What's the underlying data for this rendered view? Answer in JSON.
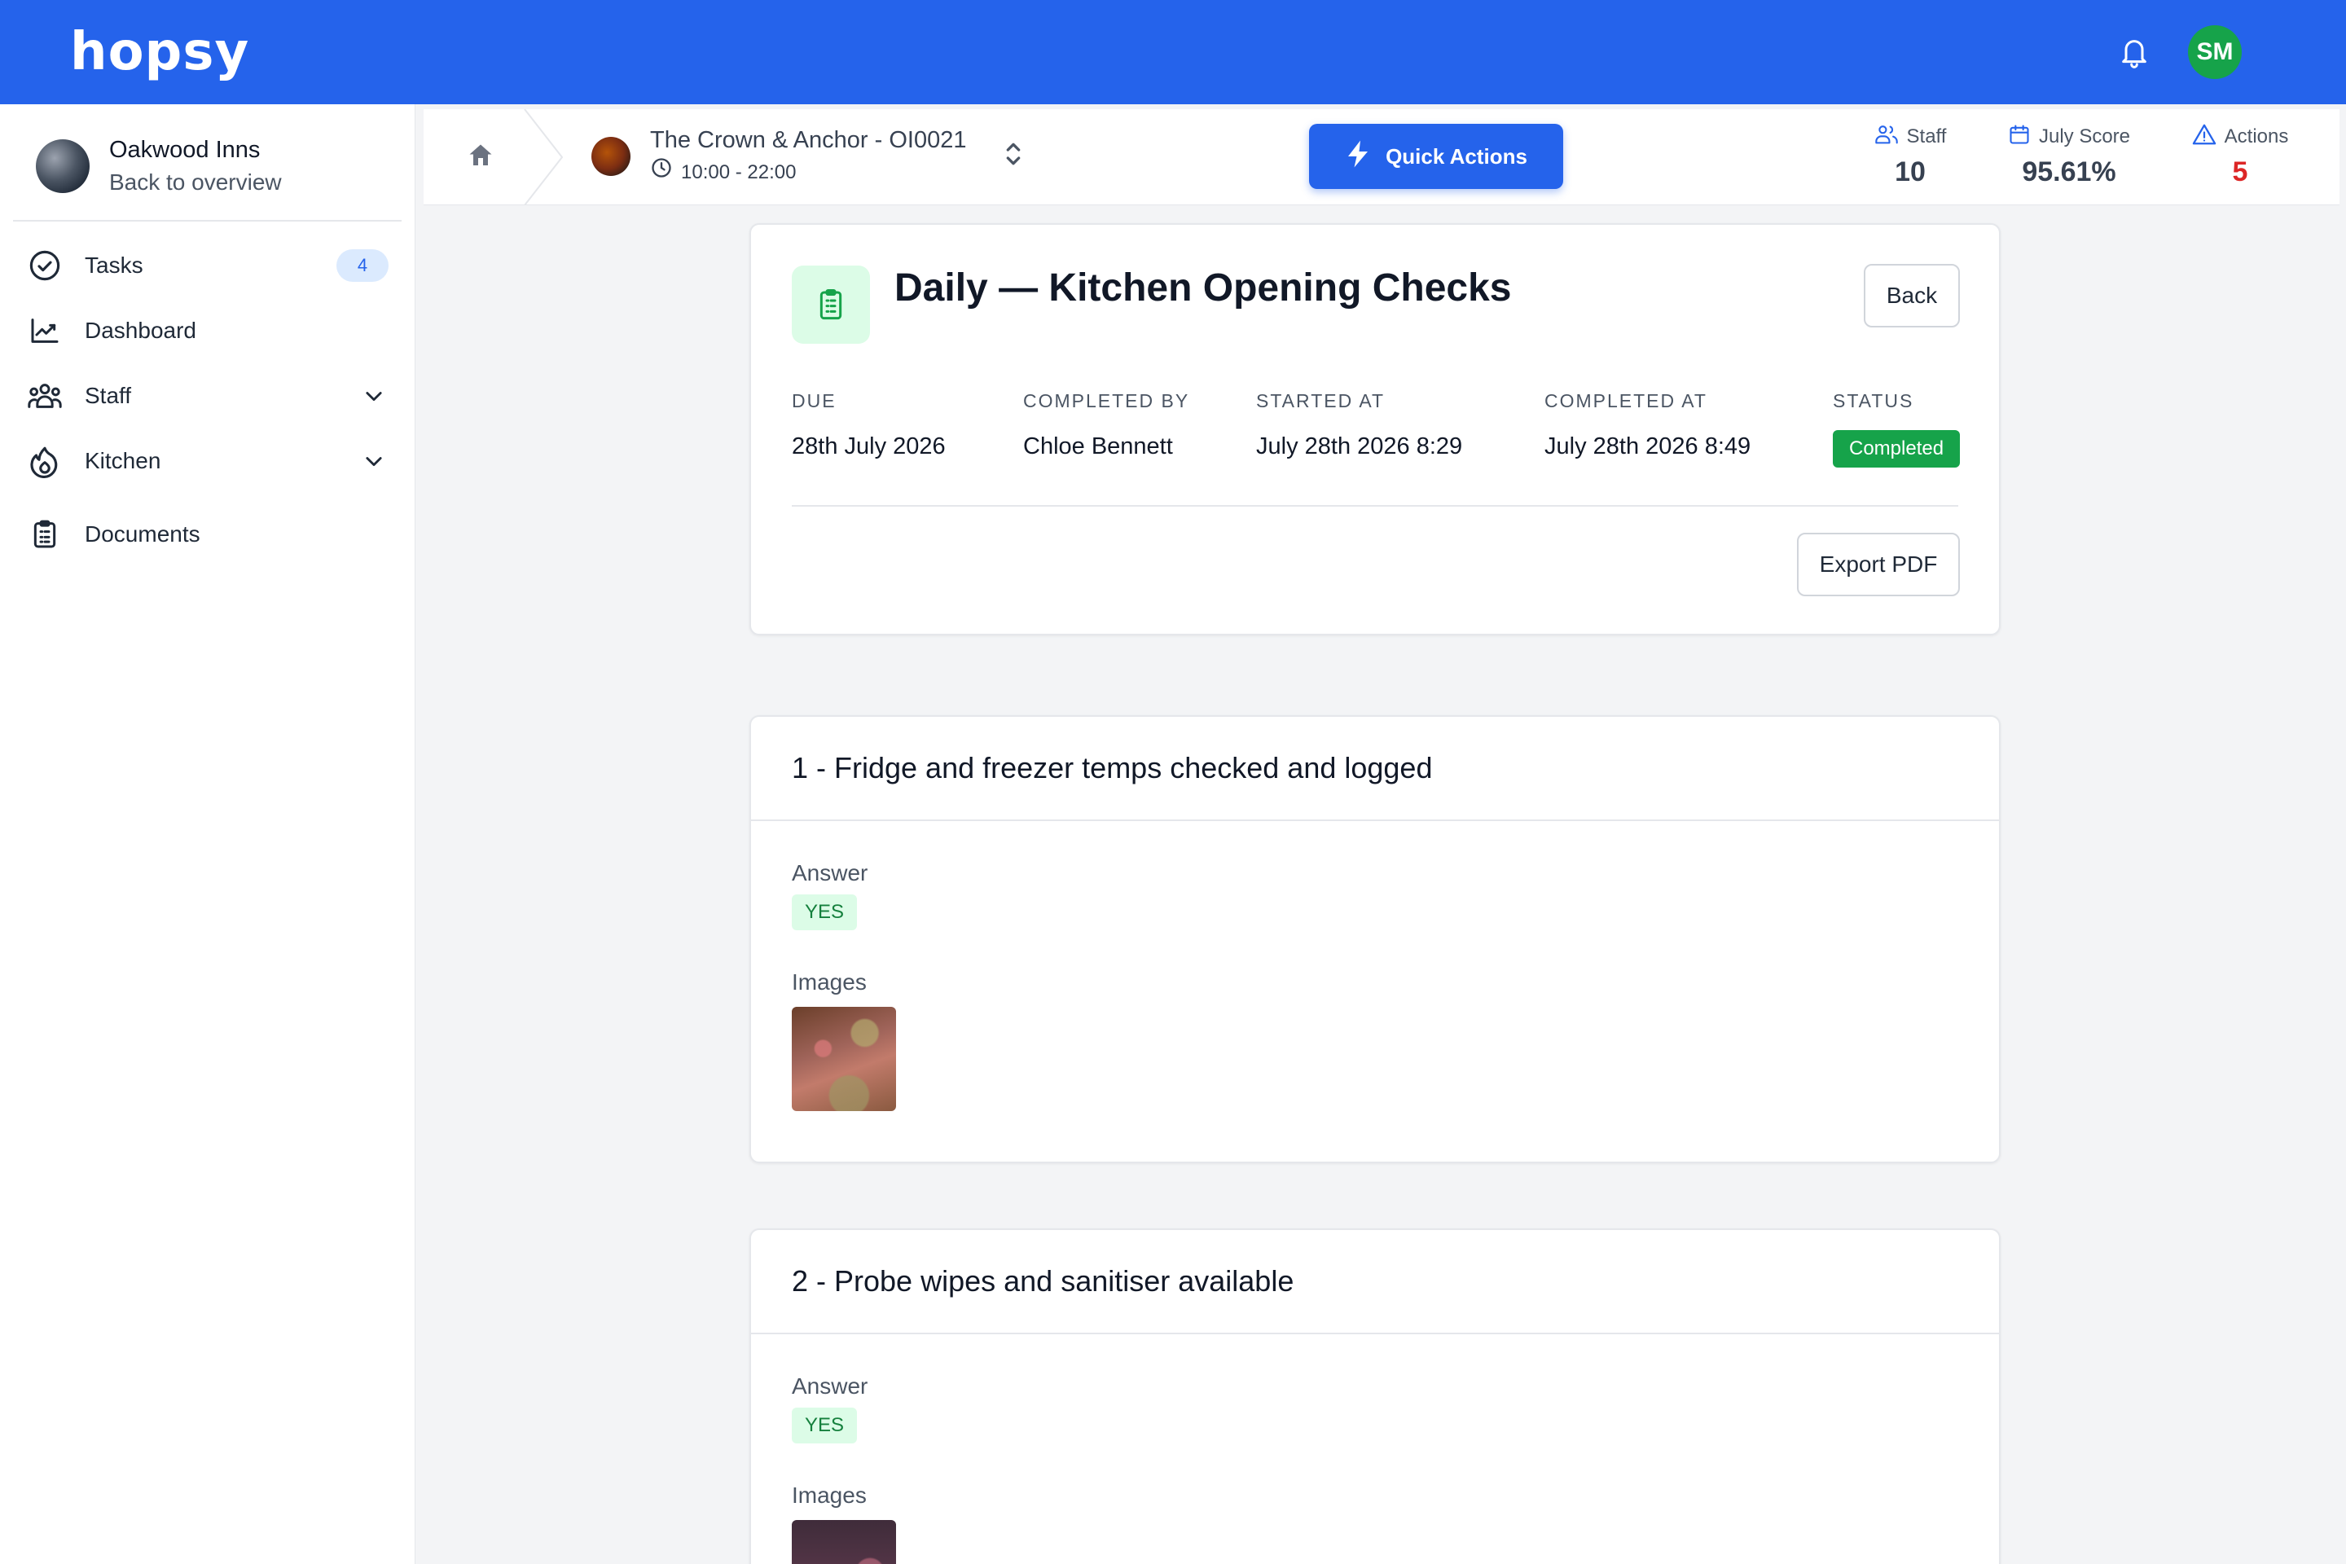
{
  "app": {
    "logo": "hopsy",
    "user_initials": "SM"
  },
  "sidebar": {
    "org_name": "Oakwood Inns",
    "org_sub": "Back to overview",
    "items": [
      {
        "label": "Tasks",
        "icon": "check-circle-icon",
        "badge": "4"
      },
      {
        "label": "Dashboard",
        "icon": "chart-line-icon"
      },
      {
        "label": "Staff",
        "icon": "users-icon"
      },
      {
        "label": "Kitchen",
        "icon": "flame-icon"
      },
      {
        "label": "Documents",
        "icon": "clipboard-icon"
      }
    ]
  },
  "context": {
    "site_name": "The Crown & Anchor - OI0021",
    "site_hours": "10:00 - 22:00",
    "quick_actions": "Quick Actions",
    "stats": [
      {
        "label": "Staff",
        "value": "10",
        "icon": "users-icon"
      },
      {
        "label": "July Score",
        "value": "95.61%",
        "icon": "calendar-icon"
      },
      {
        "label": "Actions",
        "value": "5",
        "icon": "warning-icon",
        "color": "#dc2626"
      }
    ]
  },
  "checklist": {
    "title": "Daily — Kitchen Opening Checks",
    "back_label": "Back",
    "export_label": "Export PDF",
    "meta": [
      {
        "label": "DUE",
        "value": "28th July 2026"
      },
      {
        "label": "COMPLETED BY",
        "value": "Chloe Bennett"
      },
      {
        "label": "STARTED AT",
        "value": "July 28th 2026 8:29"
      },
      {
        "label": "COMPLETED AT",
        "value": "July 28th 2026 8:49"
      },
      {
        "label": "STATUS",
        "value": "Completed"
      }
    ]
  },
  "questions": [
    {
      "title": "1 - Fridge and freezer temps checked and logged",
      "answer_label": "Answer",
      "answer": "YES",
      "images_label": "Images"
    },
    {
      "title": "2 - Probe wipes and sanitiser available",
      "answer_label": "Answer",
      "answer": "YES",
      "images_label": "Images"
    }
  ],
  "colors": {
    "brand": "#2563eb",
    "success": "#16a34a",
    "danger": "#dc2626"
  }
}
